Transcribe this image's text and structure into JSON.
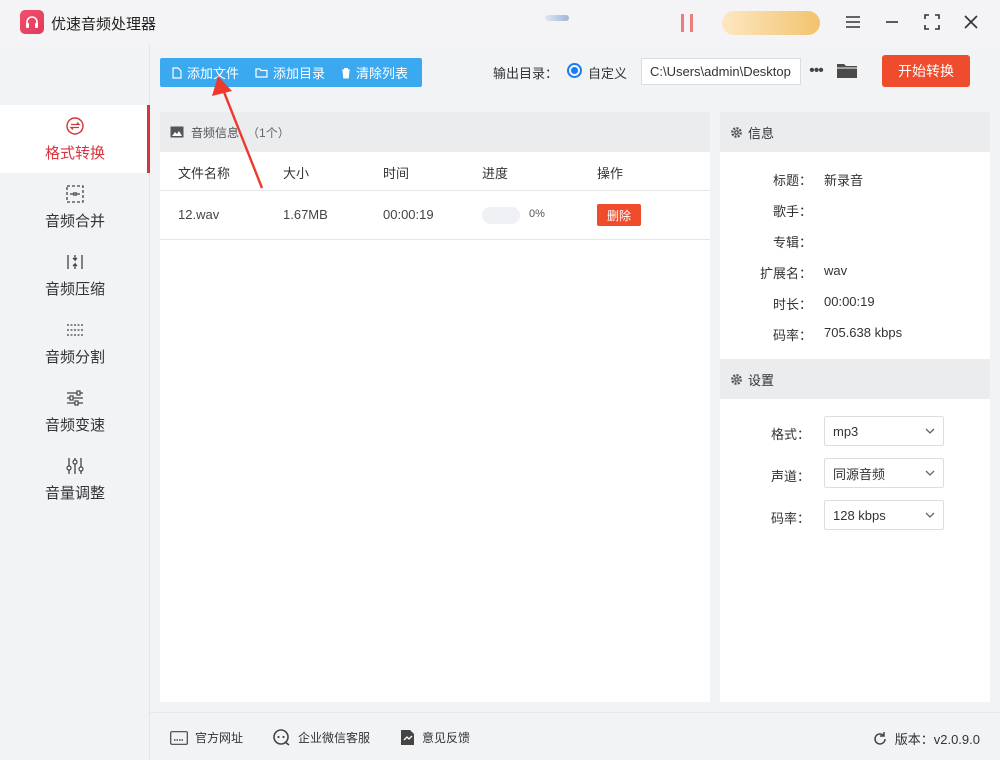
{
  "app": {
    "title": "优速音频处理器"
  },
  "window_controls": {
    "menu_icon": "menu-icon",
    "minimize_icon": "minimize-icon",
    "maximize_icon": "maximize-icon",
    "close_icon": "close-icon"
  },
  "sidebar": {
    "items": [
      {
        "label": "格式转换",
        "icon": "convert-icon",
        "active": true
      },
      {
        "label": "音频合并",
        "icon": "merge-icon",
        "active": false
      },
      {
        "label": "音频压缩",
        "icon": "compress-icon",
        "active": false
      },
      {
        "label": "音频分割",
        "icon": "split-icon",
        "active": false
      },
      {
        "label": "音频变速",
        "icon": "speed-icon",
        "active": false
      },
      {
        "label": "音量调整",
        "icon": "volume-icon",
        "active": false
      }
    ]
  },
  "toolbar": {
    "add_file": "添加文件",
    "add_folder": "添加目录",
    "clear_list": "清除列表",
    "output_label": "输出目录：",
    "custom_option": "自定义",
    "output_path": "C:\\Users\\admin\\Desktop",
    "start": "开始转换"
  },
  "file_panel": {
    "header": "音频信息",
    "count": "（1个）",
    "columns": [
      "文件名称",
      "大小",
      "时间",
      "进度",
      "操作"
    ],
    "rows": [
      {
        "name": "12.wav",
        "size": "1.67MB",
        "time": "00:00:19",
        "progress": 0,
        "progress_text": "0%",
        "action": "删除"
      }
    ]
  },
  "info_panel": {
    "header": "信息",
    "fields": [
      {
        "key": "标题：",
        "value": "新录音"
      },
      {
        "key": "歌手：",
        "value": ""
      },
      {
        "key": "专辑：",
        "value": ""
      },
      {
        "key": "扩展名：",
        "value": "wav"
      },
      {
        "key": "时长：",
        "value": "00:00:19"
      },
      {
        "key": "码率：",
        "value": "705.638 kbps"
      }
    ]
  },
  "settings_panel": {
    "header": "设置",
    "fields": [
      {
        "key": "格式：",
        "value": "mp3"
      },
      {
        "key": "声道：",
        "value": "同源音频"
      },
      {
        "key": "码率：",
        "value": "128 kbps"
      }
    ]
  },
  "footer": {
    "website": "官方网址",
    "wechat": "企业微信客服",
    "feedback": "意见反馈",
    "version": "版本：v2.0.9.0"
  },
  "colors": {
    "accent_red": "#ee4c2c",
    "active_red": "#d7353d",
    "toolbar_blue": "#3aa9f0",
    "radio_blue": "#1a7cf0"
  }
}
